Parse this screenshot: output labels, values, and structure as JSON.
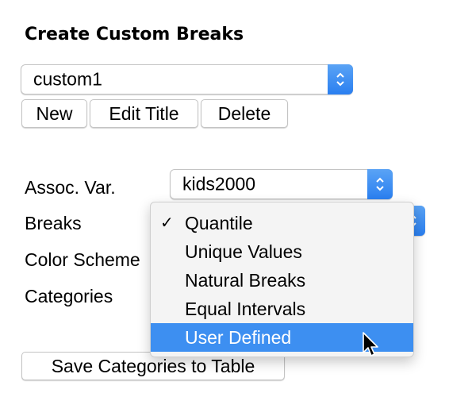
{
  "section_title": "Create Custom Breaks",
  "custom_select": {
    "value": "custom1"
  },
  "buttons": {
    "new": "New",
    "edit_title": "Edit Title",
    "delete": "Delete",
    "save": "Save Categories to Table"
  },
  "fields": {
    "assoc_var": {
      "label": "Assoc. Var.",
      "value": "kids2000"
    },
    "breaks": {
      "label": "Breaks"
    },
    "color_scheme": {
      "label": "Color Scheme"
    },
    "categories": {
      "label": "Categories"
    }
  },
  "breaks_menu": {
    "items": [
      {
        "label": "Quantile",
        "checked": true
      },
      {
        "label": "Unique Values",
        "checked": false
      },
      {
        "label": "Natural Breaks",
        "checked": false
      },
      {
        "label": "Equal Intervals",
        "checked": false
      },
      {
        "label": "User Defined",
        "checked": false,
        "highlighted": true
      }
    ],
    "check_glyph": "✓"
  },
  "colors": {
    "accent": "#2a7ff0",
    "highlight": "#3d8ff1"
  },
  "icons": {
    "popup_arrows": "chevron-up-down-icon",
    "cursor": "arrow-cursor-icon"
  }
}
